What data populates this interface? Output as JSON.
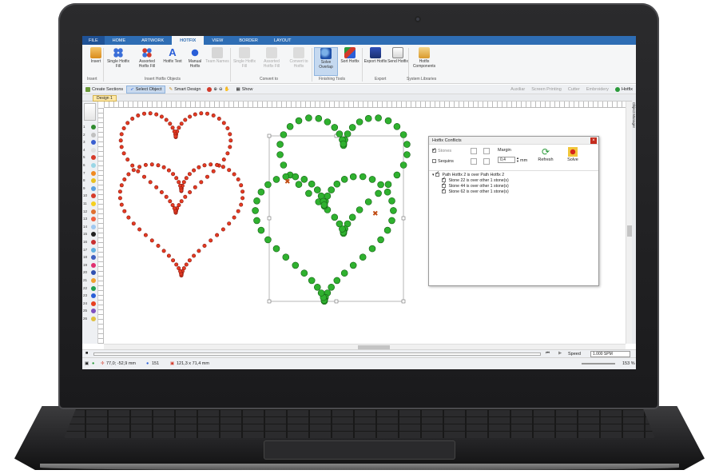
{
  "ribbon": {
    "tabs": [
      "FILE",
      "HOME",
      "ARTWORK",
      "HOTFIX",
      "VIEW",
      "BORDER",
      "LAYOUT"
    ],
    "active_tab": "HOTFIX",
    "buttons": {
      "insert": "Insert",
      "single_hotfix_fill": "Single Hotfix Fill",
      "assorted_hotfix_fill": "Assorted Hotfix Fill",
      "hotfix_text": "Hotfix Text",
      "manual_hotfix": "Manual Hotfix",
      "team_names": "Team Names",
      "single_hotfix_fill_2": "Single Hotfix Fill",
      "assorted_hotfix_fill_2": "Assorted Hotfix Fill",
      "convert_to_hotfix": "Convert to Hotfix",
      "solve_overlap": "Solve Overlap",
      "sort_hotfix": "Sort Hotfix",
      "export_hotfix": "Export Hotfix",
      "send_hotfix": "Send Hotfix",
      "hotfix_components": "Hotfix Components"
    },
    "groups": {
      "insert": "Insert",
      "insert_hotfix_objects": "Insert Hotfix Objects",
      "convert_to": "Convert to",
      "finishing_tools": "Finishing Tools",
      "export": "Export",
      "system_libraries": "System Libraries"
    }
  },
  "toolbar": {
    "create_sections": "Create Sections",
    "select_object": "Select Object",
    "smart_design": "Smart Design",
    "show": "Show",
    "auxiliar": "Auxiliar",
    "screen_printing": "Screen Printing",
    "cutter": "Cutter",
    "embroidery": "Embroidery",
    "hotfix": "Hotfix"
  },
  "document": {
    "tab": "Design 1",
    "object_manager": "Object Manager"
  },
  "palette": [
    "1",
    "2",
    "3",
    "4",
    "5",
    "6",
    "7",
    "8",
    "9",
    "10",
    "11",
    "12",
    "13",
    "14",
    "15",
    "16",
    "17",
    "18",
    "19",
    "20",
    "21",
    "22",
    "23",
    "24",
    "25",
    "26"
  ],
  "palette_colors": [
    "#2e8b2e",
    "#c0c0c0",
    "#3a5fd0",
    "#e0e0e0",
    "#d63b2b",
    "#9ad6e6",
    "#f08a22",
    "#e8c020",
    "#5aa0e0",
    "#d63b2b",
    "#f5d020",
    "#e07030",
    "#f06040",
    "#a0c8f0",
    "#222222",
    "#c83030",
    "#60b0e0",
    "#4060c0",
    "#e03070",
    "#3050b0",
    "#f0a030",
    "#20a050",
    "#2a5fd8",
    "#e84020",
    "#8050c0",
    "#e0c040"
  ],
  "hotfix_conflicts": {
    "title": "Hotfix Conflicts",
    "stones_label": "Stones",
    "sequins_label": "Sequins",
    "margin_label": "Margin",
    "margin_value": "0,4",
    "margin_unit": "mm",
    "refresh": "Refresh",
    "solve": "Solve",
    "tree": {
      "root": "Path Hotfix 2 is over Path Hotfix 2",
      "items": [
        "Stone 22 is over other 1 stone(s)",
        "Stone 44 is over other 1 stone(s)",
        "Stone 62 is over other 1 stone(s)"
      ]
    }
  },
  "playback": {
    "speed_label": "Speed",
    "speed_value": "1.000 SPM"
  },
  "status": {
    "coords": "77,0; -52,9 mm",
    "count": "151",
    "size": "121,3 x 71,4 mm",
    "zoom": "153 %"
  }
}
